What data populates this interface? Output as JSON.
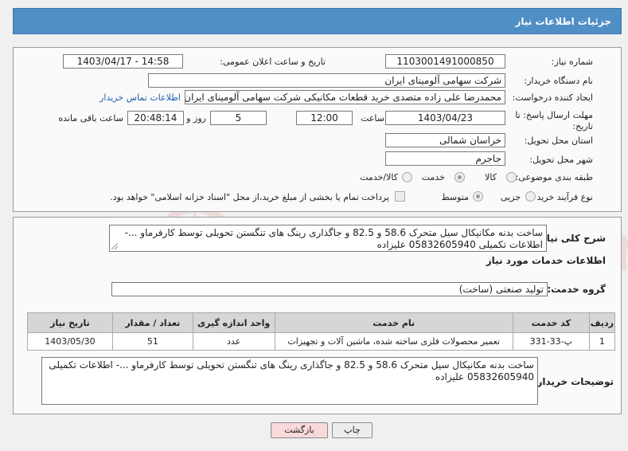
{
  "header": {
    "title": "جزئیات اطلاعات نیاز"
  },
  "need_number": {
    "label": "شماره نیاز:",
    "value": "1103001491000850"
  },
  "announce_datetime": {
    "label": "تاریخ و ساعت اعلان عمومی:",
    "value": "1403/04/17 - 14:58"
  },
  "buyer_org": {
    "label": "نام دستگاه خریدار:",
    "value": "شرکت سهامی آلومینای ایران"
  },
  "requester": {
    "label": "ایجاد کننده درخواست:",
    "value": "محمدرضا علی زاده متصدی خرید قطعات مکانیکی شرکت سهامی آلومینای ایران",
    "contact_link": "اطلاعات تماس خریدار"
  },
  "deadline": {
    "label": "مهلت ارسال پاسخ: تا تاریخ:",
    "date": "1403/04/23",
    "time_label": "ساعت",
    "time": "12:00",
    "days": "5",
    "days_label": "روز و",
    "remaining": "20:48:14",
    "remaining_label": "ساعت باقی مانده"
  },
  "province": {
    "label": "استان محل تحویل:",
    "value": "خراسان شمالی"
  },
  "city": {
    "label": "شهر محل تحویل:",
    "value": "جاجرم"
  },
  "category": {
    "label": "طبقه بندی موضوعی:",
    "options": [
      "کالا",
      "خدمت",
      "کالا/خدمت"
    ],
    "selected": "خدمت"
  },
  "purchase_type": {
    "label": "نوع فرآیند خرید :",
    "options": [
      "جزیی",
      "متوسط"
    ],
    "selected": "متوسط",
    "payment_note": "پرداخت تمام یا بخشی از مبلغ خرید،از محل \"اسناد خزانه اسلامی\" خواهد بود."
  },
  "summary": {
    "label": "شرح کلی نیاز:",
    "text": "ساخت بدنه مکانیکال سیل متحرک 58.6 و 82.5 و جاگذاری رینگ های تنگستن تحویلی توسط کارفرماو ...- اطلاعات تکمیلی 05832605940 علیزاده"
  },
  "services_title": "اطلاعات خدمات مورد نیاز",
  "service_group": {
    "label": "گروه خدمت:",
    "value": "تولید صنعتی (ساخت)"
  },
  "table": {
    "headers": [
      "ردیف",
      "کد خدمت",
      "نام خدمت",
      "واحد اندازه گیری",
      "تعداد / مقدار",
      "تاریخ نیاز"
    ],
    "rows": [
      [
        "1",
        "پ-33-331",
        "تعمیر محصولات فلزی ساخته شده، ماشین آلات و تجهیزات",
        "عدد",
        "51",
        "1403/05/30"
      ]
    ]
  },
  "buyer_notes": {
    "label": "توضیحات خریدار:",
    "text": "ساخت بدنه مکانیکال سیل متحرک 58.6 و 82.5 و جاگذاری رینگ های تنگستن تحویلی توسط کارفرماو ...- اطلاعات تکمیلی 05832605940 علیزاده"
  },
  "buttons": {
    "print": "چاپ",
    "back": "بازگشت"
  },
  "watermark": {
    "text": "AriaTender.neT"
  },
  "colors": {
    "header_bg": "#4f8fc6",
    "link": "#1e5fb0",
    "back_btn_bg": "#f9d9d9",
    "watermark": "#d9302a"
  }
}
